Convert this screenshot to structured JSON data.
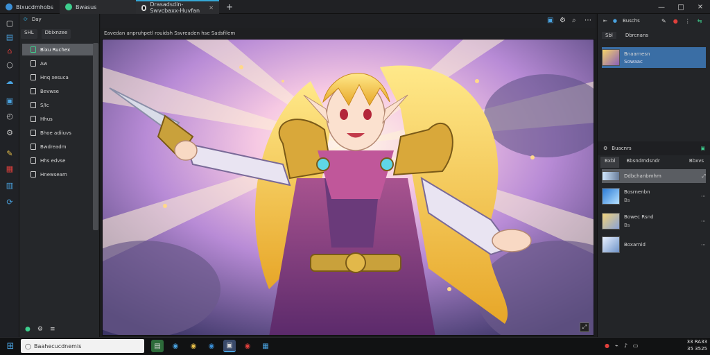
{
  "titlebar": {
    "tabs": [
      {
        "label": "Bixucdmhobs",
        "icon": "app-icon"
      },
      {
        "label": "Bwasus",
        "icon": "shield-icon"
      },
      {
        "label": "Drasadsdin-Swvcbaxx-Huvfan",
        "icon": "globe-icon"
      }
    ],
    "new_tab_symbol": "+",
    "window_controls": [
      "—",
      "□",
      "✕"
    ]
  },
  "filepanel": {
    "header_tabs": [
      "SHL",
      "Dbixnzee"
    ],
    "toolbar_label": "Day",
    "items": [
      "Bixu Ruchex",
      "Aw",
      "Hnq xesuca",
      "Bevwse",
      "S/Ic",
      "Hhus",
      "Bhoe adiiuvs",
      "Bwdreadm",
      "Hhs edvse",
      "Hnewseam"
    ],
    "selected_index": 0
  },
  "viewer": {
    "path": "Eavedan anpruhpetl rouidsh Ssvreaden hse Sadsfilem",
    "fullscreen_icon": "expand-icon"
  },
  "rightpanel": {
    "header_label": "Buschs",
    "tabs": [
      "Sbl",
      "Dbrcnans"
    ],
    "top_item": {
      "title": "Bnaarnesn",
      "sub": "Sowaac"
    },
    "section_title": "Buacnrs",
    "section_tabs": [
      "Bxbl",
      "Bbsndmdsndr",
      "Bbxvs"
    ],
    "list": [
      {
        "title": "Ddbchanbmhm",
        "sub": ""
      },
      {
        "title": "Bosrnenbn",
        "sub": "Bs"
      },
      {
        "title": "Bowec Rsnd",
        "sub": "Bs"
      },
      {
        "title": "Boxarnid",
        "sub": ""
      }
    ]
  },
  "taskbar": {
    "search_placeholder": "Baahecucdnemis",
    "clock_time": "33 RA33",
    "clock_date": "35 3525"
  },
  "colors": {
    "accent": "#35a8d6",
    "selection": "#3a6ea5",
    "panel": "#25272a"
  }
}
